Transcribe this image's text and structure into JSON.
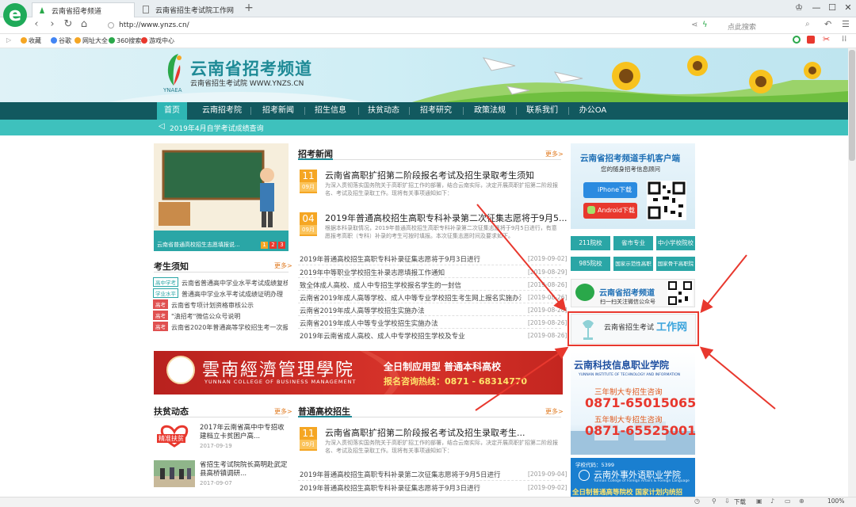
{
  "browser": {
    "tabs": [
      {
        "label": "云南省招考频道"
      },
      {
        "label": "云南省招生考试院工作网"
      }
    ],
    "new_tab": "+",
    "url": "http://www.ynzs.cn/",
    "search_placeholder": "点此搜索",
    "bookmarks": [
      {
        "label": "收藏",
        "color": "#f5a623"
      },
      {
        "label": "谷歌",
        "color": "#4285f4"
      },
      {
        "label": "网址大全",
        "color": "#f5a623"
      },
      {
        "label": "360搜索",
        "color": "#2aa84a"
      },
      {
        "label": "游戏中心",
        "color": "#e8382e"
      }
    ],
    "status": {
      "download": "下载",
      "zoom": "100%"
    }
  },
  "site": {
    "title": "云南省招考频道",
    "subtitle": "云南省招生考试院 WWW.YNZS.CN",
    "abbr": "YNAEA",
    "nav": [
      "首页",
      "云南招考院",
      "招考新闻",
      "招生信息",
      "扶贫动态",
      "招考研究",
      "政策法规",
      "联系我们",
      "办公OA"
    ],
    "notice": "2019年4月自学考试成绩查询"
  },
  "hero": {
    "caption": "云南省普通高校招生志愿填报说...",
    "pages": [
      "1",
      "2",
      "3"
    ],
    "board_text": "高考志愿填报注意事项"
  },
  "news": {
    "title": "招考新闻",
    "more": "更多>",
    "featured": [
      {
        "day": "11",
        "month": "09月",
        "title": "云南省高职扩招第二阶段报名考试及招生录取考生须知",
        "desc": "为深入贯彻落实国务院关于高职扩招工作的部署，结合云南实际，决定开展高职扩招第二阶段报名、考试及招生录取工作。现将有关事项通知如下："
      },
      {
        "day": "04",
        "month": "09月",
        "title": "2019年普通高校招生高职专科补录第二次征集志愿将于9月5...",
        "desc": "根据本科录取情况，2019年普通高校招生高职专科补录第二次征集志愿将于9月5日进行，有意愿报考高职（专科）补录的考生可按时填报。本次征集志愿时间及要求如下。"
      }
    ],
    "items": [
      {
        "text": "2019年普通高校招生高职专科补录征集志愿将于9月3日进行",
        "date": "[2019-09-02]"
      },
      {
        "text": "2019年中等职业学校招生补录志愿填报工作通知",
        "date": "[2019-08-29]"
      },
      {
        "text": "致全体成人高校、成人中专招生学校报名学生的一封信",
        "date": "[2019-08-26]"
      },
      {
        "text": "云南省2019年成人高等学校、成人中等专业学校招生考生网上报名实施办法",
        "date": "[2019-08-26]"
      },
      {
        "text": "云南省2019年成人高等学校招生实施办法",
        "date": "[2019-08-26]"
      },
      {
        "text": "云南省2019年成人中等专业学校招生实施办法",
        "date": "[2019-08-26]"
      },
      {
        "text": "2019年云南省成人高校、成人中专学校招生学校及专业",
        "date": "[2019-08-26]"
      }
    ]
  },
  "tips": {
    "title": "考生须知",
    "more": "更多>",
    "items": [
      {
        "tag": "高中学考",
        "text": "云南省普通高中学业水平考试成绩复核申请"
      },
      {
        "tag": "学业水平",
        "text": "普通高中学业水平考试成绩证明办理"
      },
      {
        "tag": "高考",
        "text": "云南省专项计划资格审核公示"
      },
      {
        "tag": "高考",
        "text": "\"滇招考\"微信公众号说明"
      },
      {
        "tag": "高考",
        "text": "云南省2020年普通高等学校招生考一次报..."
      }
    ]
  },
  "ad_banner": {
    "name_cn": "雲南經濟管理學院",
    "name_en": "YUNNAN COLLEGE OF BUSINESS MANAGEMENT",
    "slogan": "全日制应用型 普通本科高校",
    "hotline": "报名咨询热线：0871 - 68314770"
  },
  "poverty": {
    "title": "扶贫动态",
    "more": "更多>",
    "badge": "精准扶贫",
    "items": [
      {
        "title": "2017年云南省高中中专招收建档立卡贫困户高...",
        "date": "2017-09-19"
      },
      {
        "title": "省招生考试院院长高明赴武定县高桥镇调研...",
        "date": "2017-09-07"
      }
    ]
  },
  "general": {
    "title": "普通高校招生",
    "more": "更多>",
    "featured": {
      "day": "11",
      "month": "09月",
      "title": "云南省高职扩招第二阶段报名考试及招生录取考生...",
      "desc": "为深入贯彻落实国务院关于高职扩招工作的部署，结合云南实际，决定开展高职扩招第二阶段报名、考试及招生录取工作。现将有关事项通知如下："
    },
    "items": [
      {
        "text": "2019年普通高校招生高职专科补录第二次征集志愿将于9月5日进行",
        "date": "[2019-09-04]"
      },
      {
        "text": "2019年普通高校招生高职专科补录征集志愿将于9月3日进行",
        "date": "[2019-09-02]"
      }
    ]
  },
  "right": {
    "app_title": "云南省招考频道手机客户端",
    "app_sub": "您的随身招考信息顾问",
    "iphone": "iPhone下载",
    "android": "Android下载",
    "quick_links": [
      "211院校",
      "省市专业",
      "中小学校院校",
      "985院校",
      "国家示范性高职院校",
      "国家骨干高职院校"
    ],
    "wechat_title": "云南省招考频道",
    "wechat_sub": "扫一扫关注微信公众号",
    "workweb_text": "云南省招生考试",
    "workweb_accent": "工作网",
    "ad2_name": "云南科技信息职业学院",
    "ad2_en": "YUNNAN INSTITUTE OF TECHNOLOGY AND INFORMATION",
    "ad2_line1": "三年制大专招生咨询",
    "ad2_phone1": "0871-65015065",
    "ad2_line2": "五年制大专招生咨询",
    "ad2_phone2": "0871-65525001",
    "ad3_code": "学校代码：5399",
    "ad3_name": "云南外事外语职业学院",
    "ad3_en": "Yunnan College of Foreign Affairs & Foreign Language",
    "ad3_slogan": "全日制普通高等院校 国家计划内统招"
  }
}
